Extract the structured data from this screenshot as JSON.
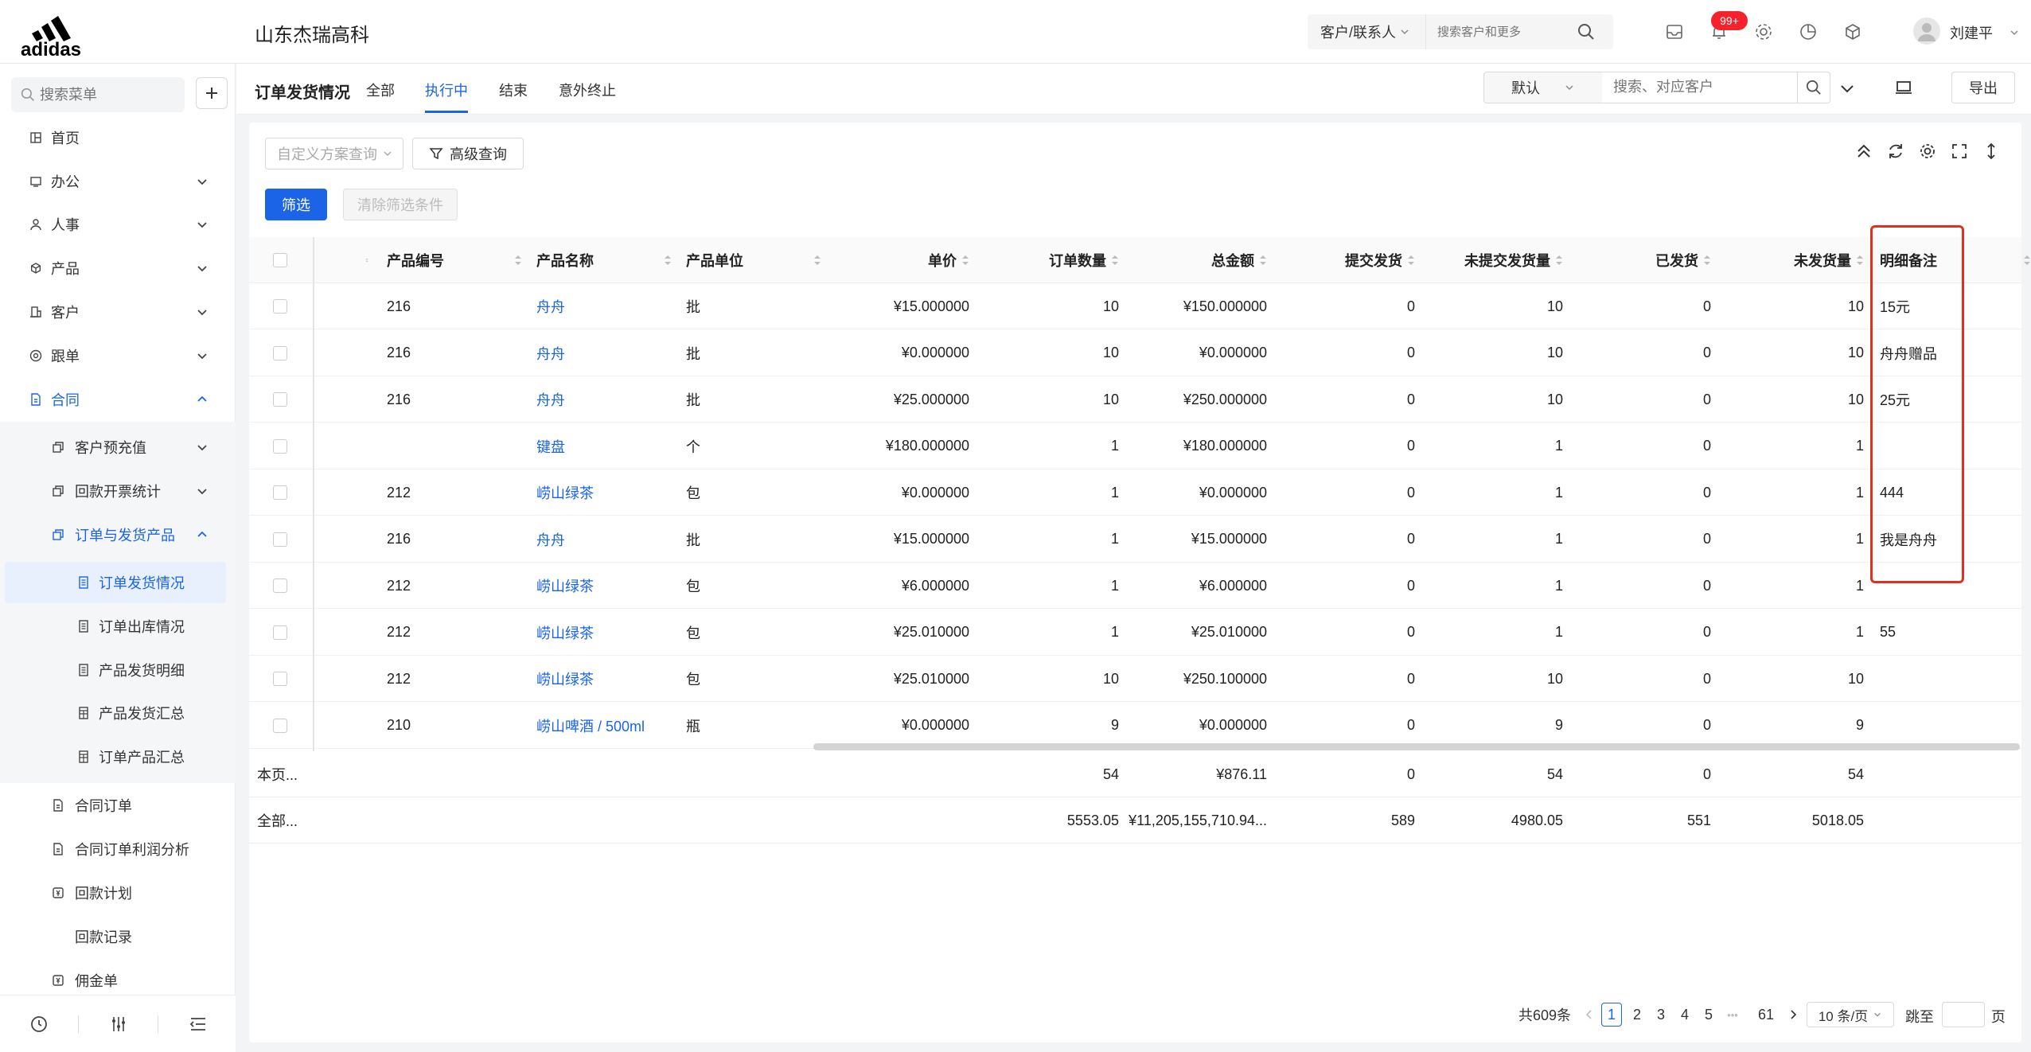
{
  "header": {
    "brand": "adidas",
    "company": "山东杰瑞高科",
    "search_scope": "客户/联系人",
    "search_placeholder": "搜索客户和更多",
    "notification_badge": "99+",
    "user_name": "刘建平"
  },
  "sidebar": {
    "search_placeholder": "搜索菜单",
    "items": [
      {
        "label": "首页"
      },
      {
        "label": "办公"
      },
      {
        "label": "人事"
      },
      {
        "label": "产品"
      },
      {
        "label": "客户"
      },
      {
        "label": "跟单"
      },
      {
        "label": "合同"
      }
    ],
    "contract_sub": [
      {
        "label": "客户预充值"
      },
      {
        "label": "回款开票统计"
      },
      {
        "label": "订单与发货产品"
      }
    ],
    "order_sub": [
      {
        "label": "订单发货情况"
      },
      {
        "label": "订单出库情况"
      },
      {
        "label": "产品发货明细"
      },
      {
        "label": "产品发货汇总"
      },
      {
        "label": "订单产品汇总"
      }
    ],
    "contract_more": [
      {
        "label": "合同订单"
      },
      {
        "label": "合同订单利润分析"
      },
      {
        "label": "回款计划"
      },
      {
        "label": "回款记录"
      },
      {
        "label": "佣金单"
      }
    ]
  },
  "page": {
    "title": "订单发货情况",
    "tabs": [
      "全部",
      "执行中",
      "结束",
      "意外终止"
    ],
    "active_tab": "执行中",
    "sort_default": "默认",
    "search_placeholder": "搜索、对应客户",
    "export_label": "导出",
    "scheme_placeholder": "自定义方案查询",
    "advanced_query": "高级查询",
    "filter_button": "筛选",
    "clear_filters": "清除筛选条件"
  },
  "table": {
    "columns": [
      "产品编号",
      "产品名称",
      "产品单位",
      "单价",
      "订单数量",
      "总金额",
      "提交发货",
      "未提交发货量",
      "已发货",
      "未发货量",
      "明细备注"
    ],
    "rows": [
      {
        "code": "216",
        "name": "舟舟",
        "unit": "批",
        "price": "¥15.000000",
        "qty": "10",
        "amount": "¥150.000000",
        "submitted": "0",
        "unsubmitted": "10",
        "shipped": "0",
        "unshipped": "10",
        "note": "15元"
      },
      {
        "code": "216",
        "name": "舟舟",
        "unit": "批",
        "price": "¥0.000000",
        "qty": "10",
        "amount": "¥0.000000",
        "submitted": "0",
        "unsubmitted": "10",
        "shipped": "0",
        "unshipped": "10",
        "note": "舟舟赠品"
      },
      {
        "code": "216",
        "name": "舟舟",
        "unit": "批",
        "price": "¥25.000000",
        "qty": "10",
        "amount": "¥250.000000",
        "submitted": "0",
        "unsubmitted": "10",
        "shipped": "0",
        "unshipped": "10",
        "note": "25元"
      },
      {
        "code": "",
        "name": "键盘",
        "unit": "个",
        "price": "¥180.000000",
        "qty": "1",
        "amount": "¥180.000000",
        "submitted": "0",
        "unsubmitted": "1",
        "shipped": "0",
        "unshipped": "1",
        "note": ""
      },
      {
        "code": "212",
        "name": "崂山绿茶",
        "unit": "包",
        "price": "¥0.000000",
        "qty": "1",
        "amount": "¥0.000000",
        "submitted": "0",
        "unsubmitted": "1",
        "shipped": "0",
        "unshipped": "1",
        "note": "444"
      },
      {
        "code": "216",
        "name": "舟舟",
        "unit": "批",
        "price": "¥15.000000",
        "qty": "1",
        "amount": "¥15.000000",
        "submitted": "0",
        "unsubmitted": "1",
        "shipped": "0",
        "unshipped": "1",
        "note": "我是舟舟"
      },
      {
        "code": "212",
        "name": "崂山绿茶",
        "unit": "包",
        "price": "¥6.000000",
        "qty": "1",
        "amount": "¥6.000000",
        "submitted": "0",
        "unsubmitted": "1",
        "shipped": "0",
        "unshipped": "1",
        "note": ""
      },
      {
        "code": "212",
        "name": "崂山绿茶",
        "unit": "包",
        "price": "¥25.010000",
        "qty": "1",
        "amount": "¥25.010000",
        "submitted": "0",
        "unsubmitted": "1",
        "shipped": "0",
        "unshipped": "1",
        "note": "55"
      },
      {
        "code": "212",
        "name": "崂山绿茶",
        "unit": "包",
        "price": "¥25.010000",
        "qty": "10",
        "amount": "¥250.100000",
        "submitted": "0",
        "unsubmitted": "10",
        "shipped": "0",
        "unshipped": "10",
        "note": ""
      },
      {
        "code": "210",
        "name": "崂山啤酒 / 500ml",
        "unit": "瓶",
        "price": "¥0.000000",
        "qty": "9",
        "amount": "¥0.000000",
        "submitted": "0",
        "unsubmitted": "9",
        "shipped": "0",
        "unshipped": "9",
        "note": ""
      }
    ],
    "summary": [
      {
        "label": "本页...",
        "qty": "54",
        "amount": "¥876.11",
        "submitted": "0",
        "unsubmitted": "54",
        "shipped": "0",
        "unshipped": "54"
      },
      {
        "label": "全部...",
        "qty": "5553.05",
        "amount": "¥11,205,155,710.94...",
        "submitted": "589",
        "unsubmitted": "4980.05",
        "shipped": "551",
        "unshipped": "5018.05"
      }
    ]
  },
  "pagination": {
    "total": "共609条",
    "pages": [
      "1",
      "2",
      "3",
      "4",
      "5"
    ],
    "current": "1",
    "ellipsis": "•••",
    "last": "61",
    "page_size": "10 条/页",
    "jump_label": "跳至",
    "page_label": "页"
  },
  "colors": {
    "accent": "#1b64e8",
    "highlight": "#e0301e",
    "badge": "#f5222d"
  }
}
